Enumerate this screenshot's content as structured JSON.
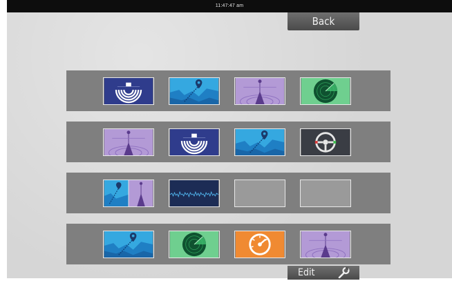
{
  "status_bar": {
    "time": "11:47:47 am"
  },
  "buttons": {
    "back_label": "Back",
    "edit_label": "Edit"
  },
  "colors": {
    "sonar": "#2f3c8c",
    "chart": "#35a8e0",
    "autopilot": "#b39ad6",
    "radar": "#6fcf8f",
    "steering": "#3a3d44",
    "echo": "#1c2c55",
    "empty": "#9a9a9a",
    "gauge": "#f08a32"
  },
  "grid": [
    [
      "sonar",
      "chart",
      "autopilot",
      "radar"
    ],
    [
      "autopilot",
      "sonar",
      "chart",
      "steering"
    ],
    [
      "chart-autopilot-split",
      "echo",
      "empty",
      "empty"
    ],
    [
      "chart",
      "radar",
      "gauge",
      "autopilot"
    ]
  ]
}
